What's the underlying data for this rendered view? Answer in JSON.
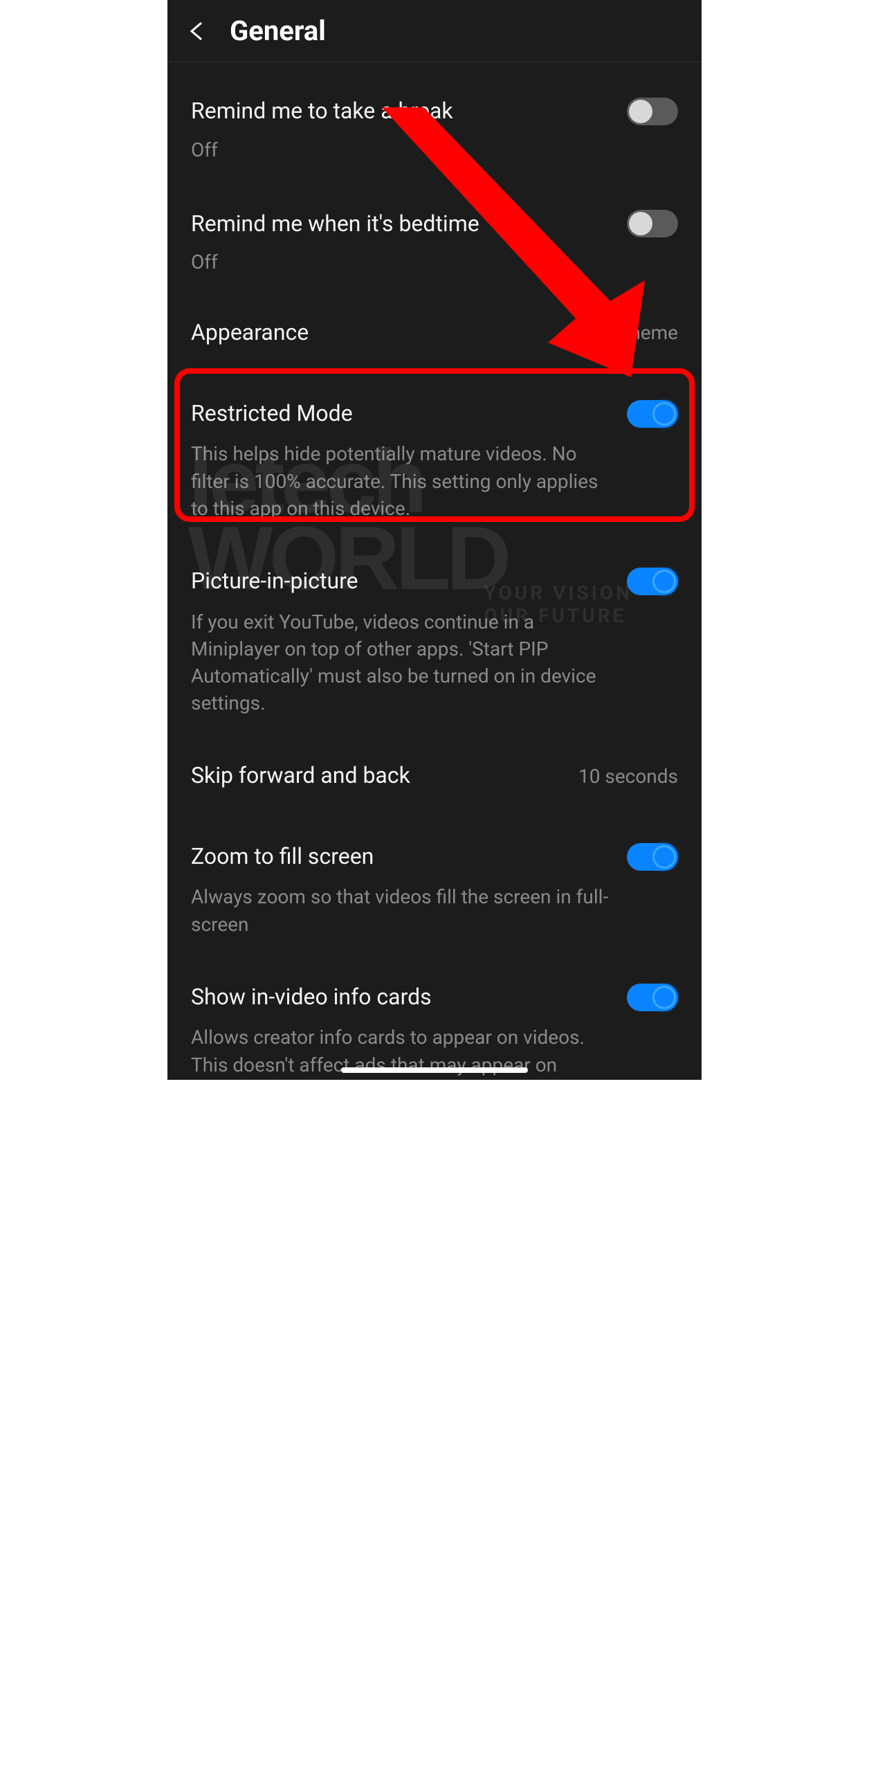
{
  "header": {
    "title": "General"
  },
  "settings": {
    "break": {
      "title": "Remind me to take a break",
      "status": "Off"
    },
    "bedtime": {
      "title": "Remind me when it's bedtime",
      "status": "Off"
    },
    "appearance": {
      "title": "Appearance",
      "value": "Dark theme"
    },
    "restricted": {
      "title": "Restricted Mode",
      "description": "This helps hide potentially mature videos. No filter is 100% accurate. This setting only applies to this app on this device."
    },
    "pip": {
      "title": "Picture-in-picture",
      "description": "If you exit YouTube, videos continue in a Miniplayer on top of other apps. 'Start PIP Automatically' must also be turned on in device settings."
    },
    "skip": {
      "title": "Skip forward and back",
      "value": "10 seconds"
    },
    "zoom": {
      "title": "Zoom to fill screen",
      "description": "Always zoom so that videos fill the screen in full-screen"
    },
    "infocards": {
      "title": "Show in-video info cards",
      "description": "Allows creator info cards to appear on videos. This doesn't affect ads that may appear on videos."
    }
  },
  "annotation": {
    "highlight_color": "#ff0000"
  },
  "watermark": {
    "line1": "letech",
    "line2": "WORLD",
    "tagline1": "YOUR VISION",
    "tagline2": "OUR FUTURE"
  }
}
